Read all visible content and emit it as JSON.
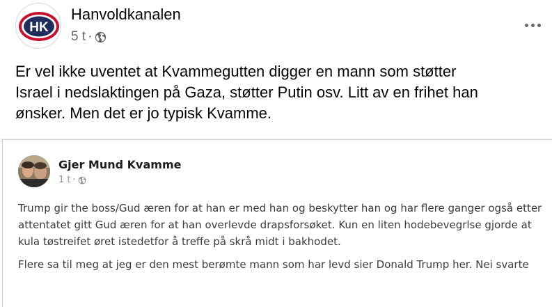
{
  "post": {
    "author": "Hanvoldkanalen",
    "logo_text": "HK",
    "time": "5 t",
    "separator": "·",
    "audience_icon": "globe-icon",
    "text": "Er vel ikke uventet at Kvammegutten digger en mann som støtter\nIsrael i nedslaktingen på Gaza, støtter Putin osv.  Litt av en frihet han\nønsker.  Men det er jo typisk Kvamme."
  },
  "shared": {
    "author": "Gjer Mund Kvamme",
    "time": "1 t",
    "separator": "·",
    "paragraph1": "Trump gir the boss/Gud æren for at han er med han og beskytter han og har flere ganger også etter attentatet gitt Gud æren for at han overlevde drapsforsøket. Kun en liten hodebevegrlse gjorde at kula tøstreifet øret istedetfor å treffe på skrå midt i bakhodet.",
    "paragraph2": "Flere sa til meg at jeg er den mest berømte mann som har levd sier Donald Trump her. Nei svarte"
  },
  "colors": {
    "logo_red": "#c8102e",
    "logo_navy": "#1f2d5c",
    "meta_gray": "#65676b"
  }
}
